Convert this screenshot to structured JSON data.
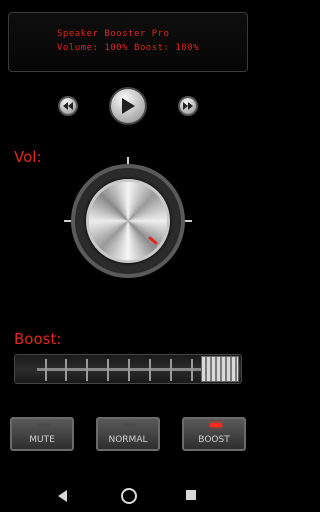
{
  "display": {
    "title": "Speaker Booster Pro",
    "status": "Volume: 100%   Boost: 100%"
  },
  "labels": {
    "vol": "Vol:",
    "boost": "Boost:"
  },
  "transport": {
    "rewind_icon": "rewind-icon",
    "play_icon": "play-icon",
    "forward_icon": "fast-forward-icon"
  },
  "boost_slider": {
    "level_percent": 100
  },
  "modes": [
    {
      "label": "MUTE",
      "active": false
    },
    {
      "label": "NORMAL",
      "active": false
    },
    {
      "label": "BOOST",
      "active": true
    }
  ],
  "colors": {
    "accent": "#e0261f",
    "background": "#000000"
  },
  "navbar": {
    "back_icon": "back-icon",
    "home_icon": "home-icon",
    "recent_icon": "recent-apps-icon"
  }
}
